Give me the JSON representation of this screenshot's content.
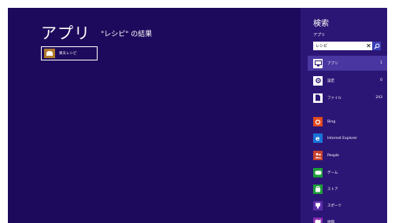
{
  "results": {
    "title": "アプリ",
    "subtitle": "\"レシピ\" の結果",
    "items": [
      {
        "label": "楽天レシピ"
      }
    ]
  },
  "charm": {
    "title": "検索",
    "scope_label": "アプリ",
    "search": {
      "value": "レシピ"
    },
    "categories": [
      {
        "label": "アプリ",
        "count": "1",
        "icon": "apps-icon"
      },
      {
        "label": "設定",
        "count": "0",
        "icon": "settings-icon"
      },
      {
        "label": "ファイル",
        "count": "243",
        "icon": "files-icon"
      }
    ],
    "apps": [
      {
        "label": "Bing",
        "icon": "bing-icon",
        "color": "#e24a1f"
      },
      {
        "label": "Internet Explorer",
        "icon": "internet-explorer-icon",
        "color": "#1a73d9"
      },
      {
        "label": "People",
        "icon": "people-icon",
        "color": "#c8422b"
      },
      {
        "label": "ゲーム",
        "icon": "games-icon",
        "color": "#1e9e3a"
      },
      {
        "label": "ストア",
        "icon": "store-icon",
        "color": "#1e9e3a"
      },
      {
        "label": "スポーツ",
        "icon": "sports-icon",
        "color": "#5a2da8"
      },
      {
        "label": "地図",
        "icon": "maps-icon",
        "color": "#8a2bb0"
      }
    ]
  },
  "colors": {
    "background": "#1e0a5c",
    "charm_background": "#2c1675",
    "selected_row": "#4a36a0",
    "search_button": "#3a3fb7"
  }
}
